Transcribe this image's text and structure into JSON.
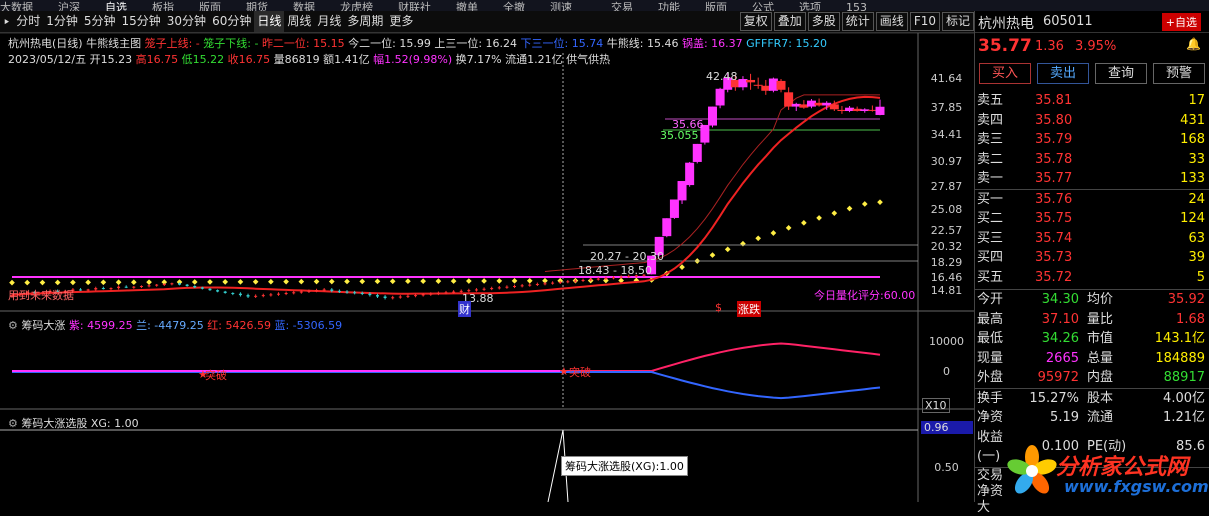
{
  "top_menu": [
    "大数据",
    "沪深",
    "自选",
    "板指",
    "版面",
    "期货",
    "数据",
    "龙虎榜",
    "财联社",
    "撤单",
    "全撤",
    "测速"
  ],
  "top_menu_right": [
    "交易",
    "功能",
    "版面",
    "公式",
    "选项",
    "153"
  ],
  "toolbar": {
    "periods": [
      "分时",
      "1分钟",
      "5分钟",
      "15分钟",
      "30分钟",
      "60分钟",
      "日线",
      "周线",
      "月线",
      "多周期",
      "更多"
    ],
    "right_buttons": [
      "复权",
      "叠加",
      "多股",
      "统计",
      "画线",
      "F10",
      "标记"
    ]
  },
  "main": {
    "title": "杭州热电(日线)",
    "indicator": "牛熊线主图",
    "l1": [
      "笼子上线: -",
      "笼子下线: -",
      "昨二一位: 15.15",
      "今二一位: 15.99",
      "上三一位: 16.24",
      "下三一位: 15.74",
      "牛熊线: 15.46",
      "锅盖: 16.37",
      "GFFFR7: 15.20"
    ],
    "l2_date": "2023/05/12/五",
    "l2": [
      "开15.23",
      "高16.75",
      "低15.22",
      "收16.75",
      "量86819",
      "额1.41亿",
      "幅1.52(9.98%)",
      "换7.17%",
      "流通1.21亿",
      "供气供热"
    ],
    "annot": {
      "peak": "42.48",
      "mid1": "35.66",
      "mid2": "35.055",
      "range1": "20.27 - 20.30",
      "range2": "18.43 - 18.50",
      "low": "13.88",
      "future": "用到未来数据",
      "score": "今日量化评分:60.00",
      "mark_cai": "财",
      "mark_s": "$",
      "mark_zd": "涨跌"
    },
    "price_levels": [
      "41.64",
      "37.85",
      "34.41",
      "30.97",
      "27.87",
      "25.08",
      "22.57",
      "20.32",
      "18.29",
      "16.46",
      "14.81"
    ]
  },
  "sub1": {
    "title": "筹码大涨",
    "values": [
      "紫: 4599.25",
      "兰: -4479.25",
      "红: 5426.59",
      "蓝: -5306.59"
    ],
    "levels": [
      "10000",
      "0"
    ],
    "tupo1": "突破",
    "tupo2": "突破",
    "x10": "X10"
  },
  "sub2": {
    "title": "筹码大涨选股",
    "value": "XG: 1.00",
    "levels": [
      "0.96",
      "0.50"
    ],
    "tooltip": "筹码大涨选股(XG):1.00"
  },
  "stock": {
    "name": "杭州热电",
    "code": "605011",
    "add_label": "+自选",
    "price": "35.77",
    "change": "1.36",
    "pct": "3.95%"
  },
  "actions": [
    "买入",
    "卖出",
    "查询",
    "预警"
  ],
  "orderbook": {
    "asks": [
      {
        "l": "卖五",
        "p": "35.81",
        "v": "17"
      },
      {
        "l": "卖四",
        "p": "35.80",
        "v": "431"
      },
      {
        "l": "卖三",
        "p": "35.79",
        "v": "168"
      },
      {
        "l": "卖二",
        "p": "35.78",
        "v": "33"
      },
      {
        "l": "卖一",
        "p": "35.77",
        "v": "133"
      }
    ],
    "bids": [
      {
        "l": "买一",
        "p": "35.76",
        "v": "24"
      },
      {
        "l": "买二",
        "p": "35.75",
        "v": "124"
      },
      {
        "l": "买三",
        "p": "35.74",
        "v": "63"
      },
      {
        "l": "买四",
        "p": "35.73",
        "v": "39"
      },
      {
        "l": "买五",
        "p": "35.72",
        "v": "5"
      }
    ]
  },
  "stats": [
    [
      "今开",
      "34.30",
      "均价",
      "35.92"
    ],
    [
      "最高",
      "37.10",
      "量比",
      "1.68"
    ],
    [
      "最低",
      "34.26",
      "市值",
      "143.1亿"
    ],
    [
      "现量",
      "2665",
      "总量",
      "184889"
    ],
    [
      "外盘",
      "95972",
      "内盘",
      "88917"
    ]
  ],
  "stats2": [
    [
      "换手",
      "15.27%",
      "股本",
      "4.00亿"
    ],
    [
      "净资",
      "5.19",
      "流通",
      "1.21亿"
    ],
    [
      "收益(一)",
      "0.100",
      "PE(动)",
      "85.6"
    ]
  ],
  "bottom_labels": [
    "交易",
    "净资",
    "大"
  ],
  "watermark": {
    "brand": "分析家公式网",
    "url": "www.fxgsw.com"
  },
  "chart_data": {
    "type": "candlestick",
    "dates_last": "2023/05/12",
    "ohlc": [
      [
        13.6,
        13.8,
        13.5,
        13.7
      ],
      [
        13.7,
        13.9,
        13.6,
        13.8
      ],
      [
        13.8,
        14.0,
        13.7,
        13.9
      ],
      [
        13.9,
        14.0,
        13.8,
        13.85
      ],
      [
        13.85,
        13.95,
        13.75,
        13.9
      ],
      [
        13.9,
        14.1,
        13.8,
        14.0
      ],
      [
        14.0,
        14.1,
        13.9,
        13.95
      ],
      [
        13.95,
        14.05,
        13.85,
        14.0
      ],
      [
        14.0,
        14.2,
        13.9,
        14.1
      ],
      [
        14.1,
        14.2,
        14.0,
        14.05
      ],
      [
        14.05,
        14.15,
        13.95,
        14.1
      ],
      [
        14.1,
        14.3,
        14.0,
        14.2
      ],
      [
        14.2,
        14.3,
        14.1,
        14.15
      ],
      [
        14.15,
        14.25,
        14.05,
        14.2
      ],
      [
        14.2,
        14.4,
        14.1,
        14.3
      ],
      [
        14.3,
        14.4,
        14.2,
        14.25
      ],
      [
        14.25,
        14.35,
        14.15,
        14.3
      ],
      [
        14.3,
        14.4,
        14.2,
        14.35
      ],
      [
        14.35,
        14.45,
        14.25,
        14.4
      ],
      [
        14.4,
        14.5,
        14.3,
        14.45
      ],
      [
        14.45,
        14.55,
        14.35,
        14.5
      ],
      [
        14.5,
        14.6,
        14.4,
        14.55
      ],
      [
        14.55,
        14.6,
        14.4,
        14.45
      ],
      [
        14.45,
        14.5,
        14.3,
        14.35
      ],
      [
        14.35,
        14.4,
        14.2,
        14.25
      ],
      [
        14.25,
        14.3,
        14.1,
        14.15
      ],
      [
        14.15,
        14.2,
        14.0,
        14.05
      ],
      [
        14.05,
        14.1,
        13.9,
        13.95
      ],
      [
        13.95,
        14.0,
        13.8,
        13.85
      ],
      [
        13.85,
        13.9,
        13.7,
        13.8
      ],
      [
        13.8,
        13.9,
        13.6,
        13.7
      ],
      [
        13.7,
        13.8,
        13.5,
        13.6
      ],
      [
        13.6,
        13.75,
        13.5,
        13.65
      ],
      [
        13.65,
        13.8,
        13.55,
        13.7
      ],
      [
        13.7,
        13.85,
        13.6,
        13.75
      ],
      [
        13.75,
        13.9,
        13.65,
        13.8
      ],
      [
        13.8,
        13.95,
        13.7,
        13.85
      ],
      [
        13.85,
        14.0,
        13.75,
        13.9
      ],
      [
        13.9,
        14.05,
        13.8,
        13.95
      ],
      [
        13.95,
        14.1,
        13.85,
        14.0
      ],
      [
        14.0,
        14.15,
        13.9,
        14.05
      ],
      [
        14.05,
        14.2,
        13.95,
        14.1
      ],
      [
        14.1,
        14.2,
        13.9,
        14.0
      ],
      [
        14.0,
        14.1,
        13.85,
        13.95
      ],
      [
        13.95,
        14.05,
        13.8,
        13.9
      ],
      [
        13.9,
        14.0,
        13.75,
        13.85
      ],
      [
        13.85,
        13.95,
        13.7,
        13.8
      ],
      [
        13.8,
        13.9,
        13.6,
        13.7
      ],
      [
        13.7,
        13.8,
        13.5,
        13.6
      ],
      [
        13.6,
        13.7,
        13.4,
        13.5
      ],
      [
        13.5,
        13.65,
        13.4,
        13.55
      ],
      [
        13.55,
        13.7,
        13.45,
        13.6
      ],
      [
        13.6,
        13.75,
        13.5,
        13.65
      ],
      [
        13.65,
        13.8,
        13.55,
        13.7
      ],
      [
        13.7,
        13.85,
        13.6,
        13.75
      ],
      [
        13.75,
        13.9,
        13.65,
        13.8
      ],
      [
        13.8,
        13.95,
        13.7,
        13.85
      ],
      [
        13.85,
        14.0,
        13.75,
        13.9
      ],
      [
        13.9,
        14.05,
        13.8,
        13.95
      ],
      [
        13.95,
        14.1,
        13.85,
        14.0
      ],
      [
        14.0,
        14.15,
        13.9,
        14.05
      ],
      [
        14.05,
        14.2,
        13.95,
        14.1
      ],
      [
        14.1,
        14.25,
        14.0,
        14.15
      ],
      [
        14.15,
        14.3,
        14.05,
        14.2
      ],
      [
        14.2,
        14.35,
        14.1,
        14.25
      ],
      [
        14.25,
        14.4,
        14.15,
        14.3
      ],
      [
        14.3,
        14.45,
        14.2,
        14.35
      ],
      [
        14.35,
        14.5,
        14.25,
        14.4
      ],
      [
        14.4,
        14.55,
        14.3,
        14.45
      ],
      [
        14.45,
        14.6,
        14.35,
        14.5
      ],
      [
        14.5,
        14.65,
        14.4,
        14.55
      ],
      [
        14.55,
        14.7,
        14.45,
        14.6
      ],
      [
        14.6,
        14.75,
        14.5,
        14.65
      ],
      [
        14.65,
        14.8,
        14.55,
        14.7
      ],
      [
        14.7,
        14.85,
        14.6,
        14.75
      ],
      [
        14.75,
        14.9,
        14.65,
        14.8
      ],
      [
        14.8,
        14.95,
        14.7,
        14.85
      ],
      [
        14.85,
        15.0,
        14.75,
        14.9
      ],
      [
        14.9,
        15.05,
        14.8,
        14.95
      ],
      [
        14.95,
        15.1,
        14.85,
        15.0
      ],
      [
        15.0,
        15.15,
        14.9,
        15.05
      ],
      [
        15.05,
        15.2,
        14.95,
        15.1
      ],
      [
        15.1,
        15.2,
        15.0,
        15.15
      ],
      [
        15.15,
        15.25,
        15.05,
        15.2
      ],
      [
        15.23,
        16.75,
        15.22,
        16.75
      ],
      [
        16.8,
        18.43,
        16.7,
        18.43
      ],
      [
        18.5,
        20.27,
        18.4,
        20.27
      ],
      [
        20.3,
        22.3,
        20.2,
        22.3
      ],
      [
        22.2,
        24.5,
        21.8,
        24.5
      ],
      [
        24.0,
        27.0,
        23.8,
        26.9
      ],
      [
        27.0,
        29.6,
        26.8,
        29.6
      ],
      [
        29.8,
        32.6,
        29.5,
        32.6
      ],
      [
        32.5,
        35.8,
        32.2,
        35.8
      ],
      [
        36.0,
        39.4,
        35.5,
        39.2
      ],
      [
        39.0,
        42.48,
        38.5,
        41.5
      ],
      [
        41.0,
        42.0,
        38.8,
        39.5
      ],
      [
        39.5,
        41.8,
        38.9,
        41.2
      ],
      [
        41.0,
        42.3,
        39.0,
        40.5
      ],
      [
        40.0,
        41.5,
        39.2,
        39.8
      ],
      [
        39.8,
        41.0,
        38.0,
        38.8
      ],
      [
        38.8,
        41.5,
        38.5,
        41.3
      ],
      [
        40.8,
        41.2,
        38.5,
        39.0
      ],
      [
        38.5,
        39.5,
        35.2,
        35.8
      ],
      [
        35.8,
        36.5,
        35.0,
        36.3
      ],
      [
        36.2,
        37.0,
        35.4,
        35.6
      ],
      [
        35.8,
        37.2,
        35.5,
        36.9
      ],
      [
        36.5,
        37.3,
        35.8,
        36.0
      ],
      [
        36.0,
        36.8,
        35.2,
        36.5
      ],
      [
        36.2,
        36.9,
        35.0,
        35.3
      ],
      [
        35.2,
        35.9,
        34.5,
        35.0
      ],
      [
        35.0,
        35.9,
        34.8,
        35.6
      ],
      [
        35.4,
        35.8,
        34.9,
        35.0
      ],
      [
        35.0,
        35.5,
        34.7,
        35.3
      ],
      [
        35.2,
        36.0,
        34.9,
        35.1
      ],
      [
        34.3,
        37.1,
        34.26,
        35.77
      ]
    ]
  }
}
